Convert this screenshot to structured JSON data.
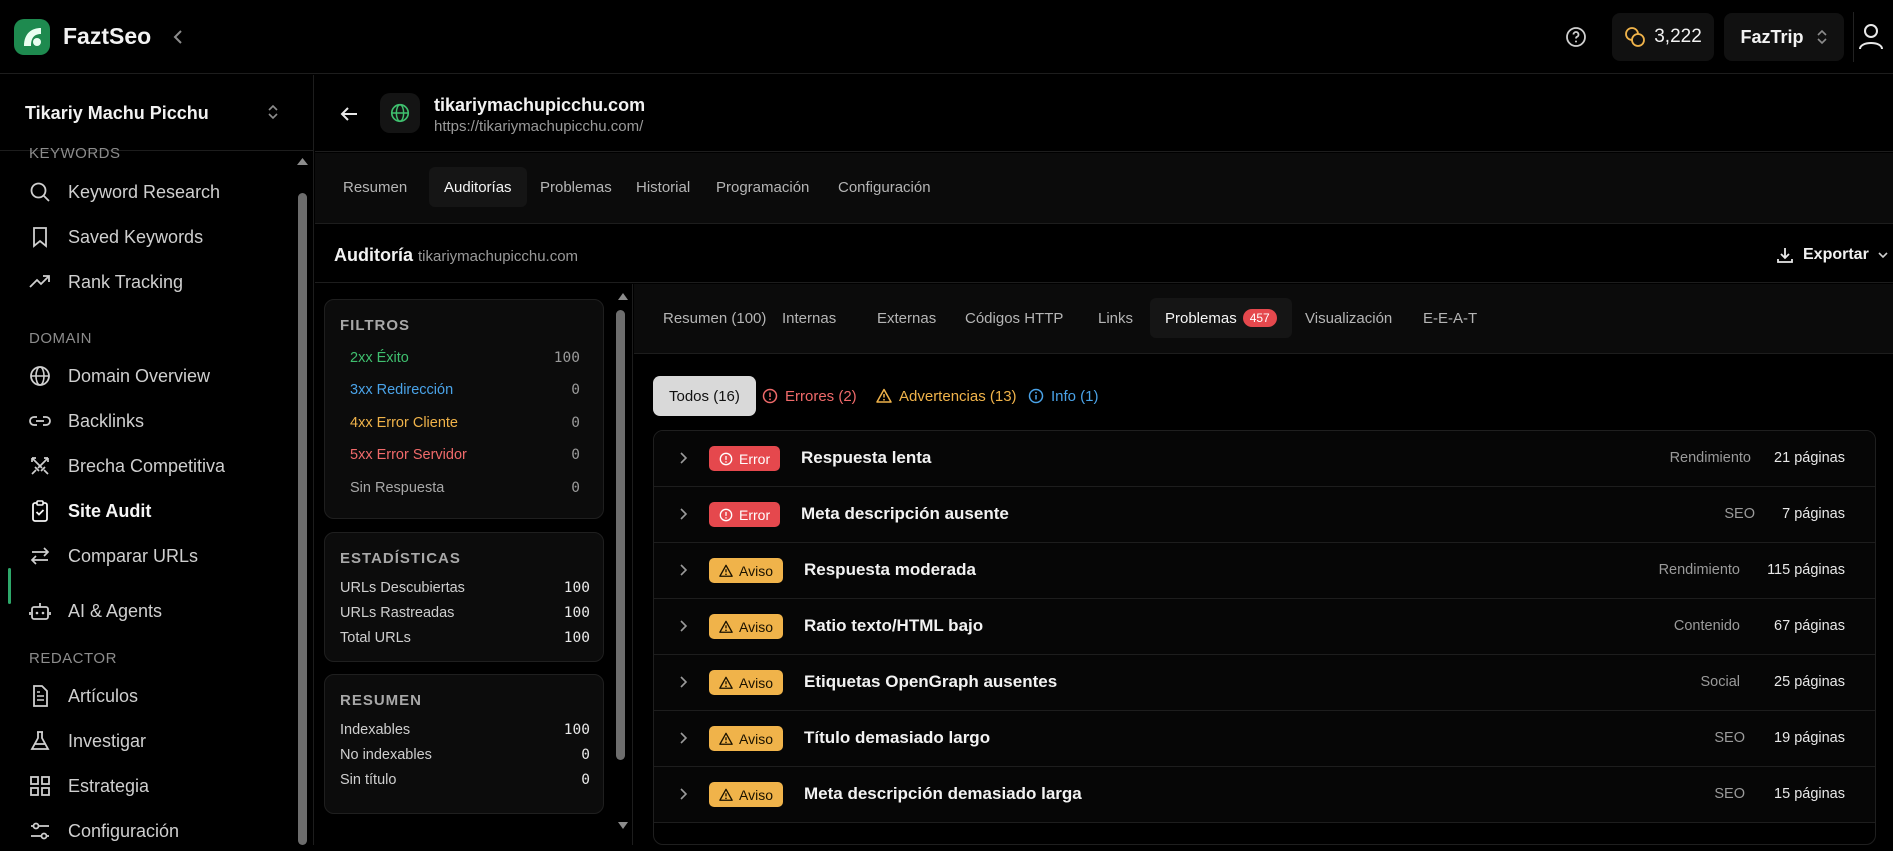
{
  "app": {
    "brand": "FaztSeo",
    "credits": "3,222",
    "workspace": "FazTrip"
  },
  "sidebar": {
    "project": "Tikariy Machu Picchu",
    "sections": {
      "keywords": "KEYWORDS",
      "domain": "DOMAIN",
      "redactor": "REDACTOR"
    },
    "items": [
      {
        "label": "Keyword Research",
        "icon": "search-icon"
      },
      {
        "label": "Saved Keywords",
        "icon": "bookmark-icon"
      },
      {
        "label": "Rank Tracking",
        "icon": "trend-icon"
      },
      {
        "label": "Domain Overview",
        "icon": "globe-icon"
      },
      {
        "label": "Backlinks",
        "icon": "link-icon"
      },
      {
        "label": "Brecha Competitiva",
        "icon": "swords-icon"
      },
      {
        "label": "Site Audit",
        "icon": "clipboard-check-icon",
        "active": true
      },
      {
        "label": "Comparar URLs",
        "icon": "compare-icon"
      },
      {
        "label": "AI & Agents",
        "icon": "bot-icon"
      },
      {
        "label": "Artículos",
        "icon": "document-icon"
      },
      {
        "label": "Investigar",
        "icon": "flask-icon"
      },
      {
        "label": "Estrategia",
        "icon": "grid-icon"
      },
      {
        "label": "Configuración",
        "icon": "settings-icon"
      }
    ]
  },
  "site": {
    "domain": "tikariymachupicchu.com",
    "url": "https://tikariymachupicchu.com/"
  },
  "main_tabs": [
    "Resumen",
    "Auditorías",
    "Problemas",
    "Historial",
    "Programación",
    "Configuración"
  ],
  "audit": {
    "title": "Auditoría",
    "domain": "tikariymachupicchu.com",
    "export_label": "Exportar"
  },
  "filters": {
    "title": "FILTROS",
    "rows": [
      {
        "label": "2xx Éxito",
        "value": "100",
        "color": "#3fbf6e"
      },
      {
        "label": "3xx Redirección",
        "value": "0",
        "color": "#4aa3e8"
      },
      {
        "label": "4xx Error Cliente",
        "value": "0",
        "color": "#f0b34a"
      },
      {
        "label": "5xx Error Servidor",
        "value": "0",
        "color": "#f06a6a"
      },
      {
        "label": "Sin Respuesta",
        "value": "0",
        "color": "#a8a8a8"
      }
    ]
  },
  "stats": {
    "title": "ESTADÍSTICAS",
    "rows": [
      {
        "label": "URLs Descubiertas",
        "value": "100"
      },
      {
        "label": "URLs Rastreadas",
        "value": "100"
      },
      {
        "label": "Total URLs",
        "value": "100"
      }
    ]
  },
  "summary": {
    "title": "RESUMEN",
    "rows": [
      {
        "label": "Indexables",
        "value": "100"
      },
      {
        "label": "No indexables",
        "value": "0"
      },
      {
        "label": "Sin título",
        "value": "0"
      }
    ]
  },
  "audit_tabs": [
    {
      "label": "Resumen (100)"
    },
    {
      "label": "Internas"
    },
    {
      "label": "Externas"
    },
    {
      "label": "Códigos HTTP"
    },
    {
      "label": "Links"
    },
    {
      "label": "Problemas",
      "count": "457",
      "active": true
    },
    {
      "label": "Visualización"
    },
    {
      "label": "E-E-A-T"
    }
  ],
  "severity_filters": {
    "all": "Todos (16)",
    "errors": "Errores (2)",
    "warnings": "Advertencias (13)",
    "info": "Info (1)"
  },
  "issues": [
    {
      "severity": "Error",
      "title": "Respuesta lenta",
      "category": "Rendimiento",
      "pages": "21 páginas"
    },
    {
      "severity": "Error",
      "title": "Meta descripción ausente",
      "category": "SEO",
      "pages": "7 páginas"
    },
    {
      "severity": "Aviso",
      "title": "Respuesta moderada",
      "category": "Rendimiento",
      "pages": "115 páginas"
    },
    {
      "severity": "Aviso",
      "title": "Ratio texto/HTML bajo",
      "category": "Contenido",
      "pages": "67 páginas"
    },
    {
      "severity": "Aviso",
      "title": "Etiquetas OpenGraph ausentes",
      "category": "Social",
      "pages": "25 páginas"
    },
    {
      "severity": "Aviso",
      "title": "Título demasiado largo",
      "category": "SEO",
      "pages": "19 páginas"
    },
    {
      "severity": "Aviso",
      "title": "Meta descripción demasiado larga",
      "category": "SEO",
      "pages": "15 páginas"
    }
  ],
  "colors": {
    "accent": "#2ea86a",
    "error": "#e5484d",
    "warning": "#f0b34a",
    "info": "#4aa3e8"
  }
}
